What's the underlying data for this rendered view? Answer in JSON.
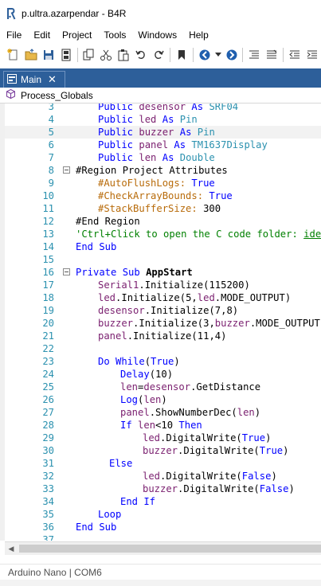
{
  "window": {
    "title": "p.ultra.azarpendar - B4R"
  },
  "menu": [
    "File",
    "Edit",
    "Project",
    "Tools",
    "Windows",
    "Help"
  ],
  "toolbar": {
    "buttons": [
      "new-file-icon",
      "open-folder-icon",
      "save-icon",
      "save-all-icon",
      "copy-icon",
      "cut-icon",
      "paste-icon",
      "undo-icon",
      "redo-icon",
      "bookmark-icon",
      "nav-back-icon",
      "nav-back-dropdown-icon",
      "nav-forward-icon",
      "comment-icon",
      "uncomment-icon",
      "outdent-icon",
      "indent-icon"
    ]
  },
  "tabs": {
    "main_label": "Main",
    "close_glyph": "✕"
  },
  "module_bar": {
    "label": "Process_Globals"
  },
  "editor": {
    "lines": [
      {
        "n": "3",
        "indent": 2,
        "segments": [
          [
            "kw",
            "Public "
          ],
          [
            "id",
            "desensor"
          ],
          [
            "kw",
            " As "
          ],
          [
            "typ",
            "SRF04"
          ]
        ]
      },
      {
        "n": "4",
        "indent": 2,
        "segments": [
          [
            "kw",
            "Public "
          ],
          [
            "id",
            "led"
          ],
          [
            "kw",
            " As "
          ],
          [
            "typ",
            "Pin"
          ]
        ]
      },
      {
        "n": "5",
        "indent": 2,
        "hl": true,
        "segments": [
          [
            "kw",
            "Public "
          ],
          [
            "id",
            "buzzer"
          ],
          [
            "kw",
            " As "
          ],
          [
            "typ",
            "Pin"
          ]
        ]
      },
      {
        "n": "6",
        "indent": 2,
        "segments": [
          [
            "kw",
            "Public "
          ],
          [
            "id",
            "panel"
          ],
          [
            "kw",
            " As "
          ],
          [
            "typ",
            "TM1637Display"
          ]
        ]
      },
      {
        "n": "7",
        "indent": 2,
        "segments": [
          [
            "kw",
            "Public "
          ],
          [
            "id",
            "len"
          ],
          [
            "kw",
            " As "
          ],
          [
            "typ",
            "Double"
          ]
        ]
      },
      {
        "n": "8",
        "indent": 0,
        "fold": true,
        "segments": [
          [
            "plain",
            "#Region Project Attributes"
          ]
        ]
      },
      {
        "n": "9",
        "indent": 2,
        "segments": [
          [
            "dir",
            "#AutoFlushLogs: "
          ],
          [
            "kw",
            "True"
          ]
        ]
      },
      {
        "n": "10",
        "indent": 2,
        "segments": [
          [
            "dir",
            "#CheckArrayBounds: "
          ],
          [
            "kw",
            "True"
          ]
        ]
      },
      {
        "n": "11",
        "indent": 2,
        "segments": [
          [
            "dir",
            "#StackBufferSize: "
          ],
          [
            "num",
            "300"
          ]
        ]
      },
      {
        "n": "12",
        "indent": 0,
        "segments": [
          [
            "plain",
            "#End Region"
          ]
        ]
      },
      {
        "n": "13",
        "indent": 0,
        "segments": [
          [
            "cm",
            "'Ctrl+Click to open the C code folder: "
          ],
          [
            "linkish",
            "ide://"
          ]
        ]
      },
      {
        "n": "14",
        "indent": 0,
        "segments": [
          [
            "kw",
            "End Sub"
          ]
        ]
      },
      {
        "n": "15",
        "indent": 0,
        "segments": []
      },
      {
        "n": "16",
        "indent": 0,
        "fold": true,
        "segments": [
          [
            "kw",
            "Private Sub "
          ],
          [
            "boldname",
            "AppStart"
          ]
        ]
      },
      {
        "n": "17",
        "indent": 2,
        "segments": [
          [
            "id",
            "Serial1"
          ],
          [
            "plain",
            "."
          ],
          [
            "plain",
            "Initialize"
          ],
          [
            "plain",
            "("
          ],
          [
            "num",
            "115200"
          ],
          [
            "plain",
            ")"
          ]
        ]
      },
      {
        "n": "18",
        "indent": 2,
        "segments": [
          [
            "id",
            "led"
          ],
          [
            "plain",
            ".Initialize("
          ],
          [
            "num",
            "5"
          ],
          [
            "plain",
            ","
          ],
          [
            "id",
            "led"
          ],
          [
            "plain",
            ".MODE_OUTPUT)"
          ]
        ]
      },
      {
        "n": "19",
        "indent": 2,
        "segments": [
          [
            "id",
            "desensor"
          ],
          [
            "plain",
            ".Initialize("
          ],
          [
            "num",
            "7"
          ],
          [
            "plain",
            ","
          ],
          [
            "num",
            "8"
          ],
          [
            "plain",
            ")"
          ]
        ]
      },
      {
        "n": "20",
        "indent": 2,
        "segments": [
          [
            "id",
            "buzzer"
          ],
          [
            "plain",
            ".Initialize("
          ],
          [
            "num",
            "3"
          ],
          [
            "plain",
            ","
          ],
          [
            "id",
            "buzzer"
          ],
          [
            "plain",
            ".MODE_OUTPUT)"
          ]
        ]
      },
      {
        "n": "21",
        "indent": 2,
        "segments": [
          [
            "id",
            "panel"
          ],
          [
            "plain",
            ".Initialize("
          ],
          [
            "num",
            "11"
          ],
          [
            "plain",
            ","
          ],
          [
            "num",
            "4"
          ],
          [
            "plain",
            ")"
          ]
        ]
      },
      {
        "n": "22",
        "indent": 0,
        "segments": []
      },
      {
        "n": "23",
        "indent": 2,
        "segments": [
          [
            "kw",
            "Do While"
          ],
          [
            "plain",
            "("
          ],
          [
            "kw",
            "True"
          ],
          [
            "plain",
            ")"
          ]
        ]
      },
      {
        "n": "24",
        "indent": 4,
        "segments": [
          [
            "kw",
            "Delay"
          ],
          [
            "plain",
            "("
          ],
          [
            "num",
            "10"
          ],
          [
            "plain",
            ")"
          ]
        ]
      },
      {
        "n": "25",
        "indent": 4,
        "segments": [
          [
            "id",
            "len"
          ],
          [
            "plain",
            "="
          ],
          [
            "id",
            "desensor"
          ],
          [
            "plain",
            ".GetDistance"
          ]
        ]
      },
      {
        "n": "26",
        "indent": 4,
        "segments": [
          [
            "kw",
            "Log"
          ],
          [
            "plain",
            "("
          ],
          [
            "id",
            "len"
          ],
          [
            "plain",
            ")"
          ]
        ]
      },
      {
        "n": "27",
        "indent": 4,
        "segments": [
          [
            "id",
            "panel"
          ],
          [
            "plain",
            ".ShowNumberDec("
          ],
          [
            "id",
            "len"
          ],
          [
            "plain",
            ")"
          ]
        ]
      },
      {
        "n": "28",
        "indent": 4,
        "segments": [
          [
            "kw",
            "If "
          ],
          [
            "id",
            "len"
          ],
          [
            "plain",
            "<"
          ],
          [
            "num",
            "10"
          ],
          [
            "kw",
            " Then"
          ]
        ]
      },
      {
        "n": "29",
        "indent": 6,
        "segments": [
          [
            "id",
            "led"
          ],
          [
            "plain",
            ".DigitalWrite("
          ],
          [
            "kw",
            "True"
          ],
          [
            "plain",
            ")"
          ]
        ]
      },
      {
        "n": "30",
        "indent": 6,
        "segments": [
          [
            "id",
            "buzzer"
          ],
          [
            "plain",
            ".DigitalWrite("
          ],
          [
            "kw",
            "True"
          ],
          [
            "plain",
            ")"
          ]
        ]
      },
      {
        "n": "31",
        "indent": 3,
        "segments": [
          [
            "kw",
            "Else"
          ]
        ]
      },
      {
        "n": "32",
        "indent": 6,
        "segments": [
          [
            "id",
            "led"
          ],
          [
            "plain",
            ".DigitalWrite("
          ],
          [
            "kw",
            "False"
          ],
          [
            "plain",
            ")"
          ]
        ]
      },
      {
        "n": "33",
        "indent": 6,
        "segments": [
          [
            "id",
            "buzzer"
          ],
          [
            "plain",
            ".DigitalWrite("
          ],
          [
            "kw",
            "False"
          ],
          [
            "plain",
            ")"
          ]
        ]
      },
      {
        "n": "34",
        "indent": 4,
        "segments": [
          [
            "kw",
            "End If"
          ]
        ]
      },
      {
        "n": "35",
        "indent": 2,
        "segments": [
          [
            "kw",
            "Loop"
          ]
        ]
      },
      {
        "n": "36",
        "indent": 0,
        "segments": [
          [
            "kw",
            "End Sub"
          ]
        ]
      },
      {
        "n": "37",
        "indent": 0,
        "segments": []
      }
    ]
  },
  "statusbar": {
    "text": "Arduino Nano | COM6"
  },
  "colors": {
    "tab_bg": "#2d5f9a",
    "line_number": "#2b91af",
    "keyword": "#0000ff",
    "comment": "#008000",
    "directive": "#b86b0a",
    "identifier": "#7a1f6f"
  }
}
